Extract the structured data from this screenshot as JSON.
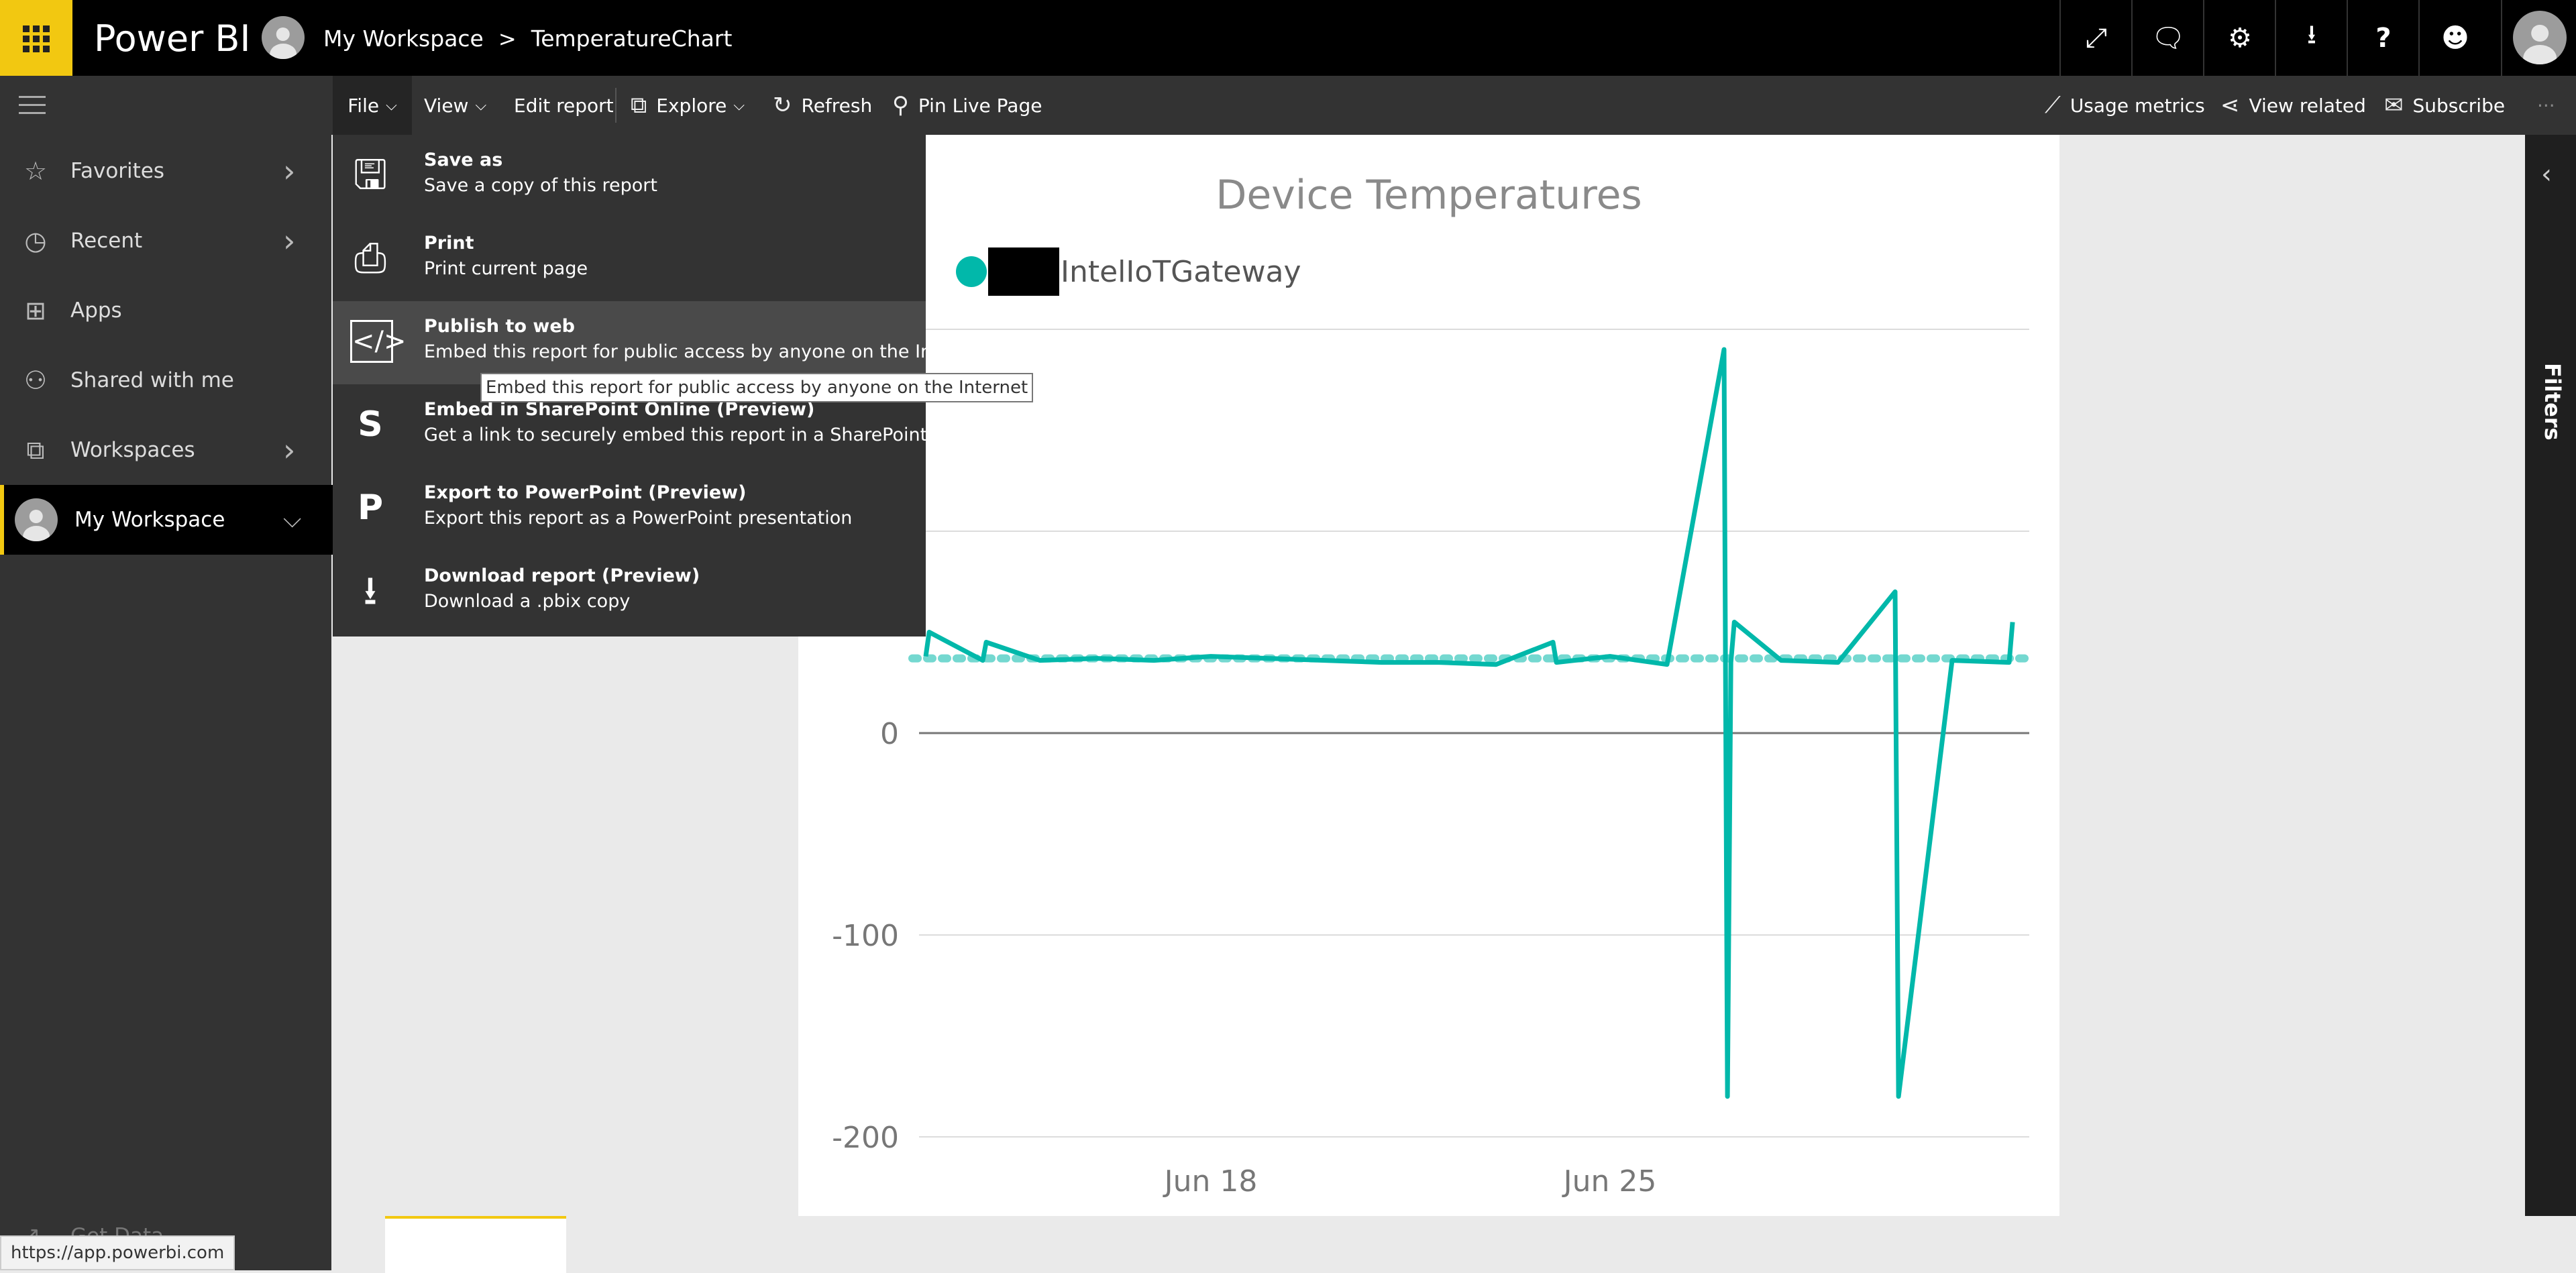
{
  "header": {
    "brand": "Power BI",
    "breadcrumb": {
      "workspace": "My Workspace",
      "separator": ">",
      "report": "TemperatureChart"
    }
  },
  "topbar_icons": [
    "fullscreen-icon",
    "comment-icon",
    "gear-icon",
    "download-icon",
    "help-icon",
    "smiley-icon",
    "user-avatar"
  ],
  "actionbar": {
    "file": "File",
    "view": "View",
    "edit_report": "Edit report",
    "explore": "Explore",
    "refresh": "Refresh",
    "pin_live_page": "Pin Live Page",
    "usage_metrics": "Usage metrics",
    "view_related": "View related",
    "subscribe": "Subscribe",
    "more": "···"
  },
  "sidebar": {
    "items": [
      {
        "label": "Favorites",
        "icon": "star-icon"
      },
      {
        "label": "Recent",
        "icon": "clock-icon"
      },
      {
        "label": "Apps",
        "icon": "apps-icon"
      },
      {
        "label": "Shared with me",
        "icon": "shared-icon"
      },
      {
        "label": "Workspaces",
        "icon": "workspaces-icon"
      },
      {
        "label": "My Workspace",
        "icon": "avatar"
      }
    ],
    "get_data": "Get Data"
  },
  "file_menu": {
    "items": [
      {
        "title": "Save as",
        "desc": "Save a copy of this report"
      },
      {
        "title": "Print",
        "desc": "Print current page"
      },
      {
        "title": "Publish to web",
        "desc": "Embed this report for public access by anyone on the Internet"
      },
      {
        "title": "Embed in SharePoint Online (Preview)",
        "desc": "Get a link to securely embed this report in a SharePoint page"
      },
      {
        "title": "Export to PowerPoint (Preview)",
        "desc": "Export this report as a PowerPoint presentation"
      },
      {
        "title": "Download report (Preview)",
        "desc": "Download a .pbix copy"
      }
    ],
    "tooltip": "Embed this report for public access by anyone on the Internet"
  },
  "filters_pane": {
    "label": "Filters"
  },
  "status_url": "https://app.powerbi.com",
  "colors": {
    "accent": "#f2c811",
    "series": "#01b8aa"
  },
  "chart_data": {
    "type": "line",
    "title": "Device Temperatures",
    "legend": {
      "position": "top-left",
      "entries": [
        "IntelIoTGateway"
      ]
    },
    "series": [
      {
        "name": "IntelIoTGateway",
        "x": [
          "Jun 13",
          "Jun 13",
          "Jun 14",
          "Jun 14",
          "Jun 15",
          "Jun 16",
          "Jun 17",
          "Jun 18",
          "Jun 19",
          "Jun 20",
          "Jun 21",
          "Jun 22",
          "Jun 23",
          "Jun 24",
          "Jun 24",
          "Jun 25",
          "Jun 26",
          "Jun 27",
          "Jun 27",
          "Jun 27",
          "Jun 27",
          "Jun 28",
          "Jun 29",
          "Jun 30",
          "Jun 30",
          "Jul 1",
          "Jul 2",
          "Jul 2"
        ],
        "y": [
          38,
          50,
          36,
          45,
          36,
          37,
          36,
          38,
          37,
          36,
          35,
          35,
          34,
          45,
          35,
          38,
          34,
          190,
          -180,
          35,
          55,
          36,
          35,
          70,
          -180,
          36,
          35,
          55
        ]
      }
    ],
    "reference_line": {
      "y": 37,
      "style": "dotted"
    },
    "x_ticks": [
      "Jun 18",
      "Jun 25"
    ],
    "y_ticks": [
      0,
      -100,
      -200
    ],
    "ylim": [
      -200,
      200
    ],
    "grid": true
  }
}
